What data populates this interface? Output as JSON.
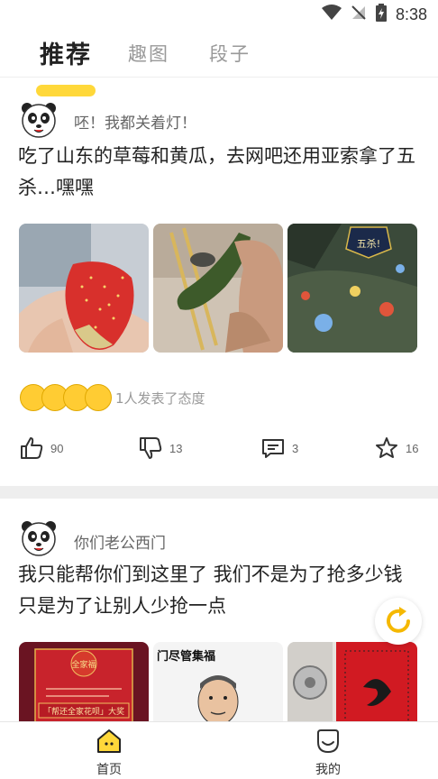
{
  "status_bar": {
    "time": "8:38"
  },
  "tabs": [
    {
      "label": "推荐",
      "active": true
    },
    {
      "label": "趣图",
      "active": false
    },
    {
      "label": "段子",
      "active": false
    }
  ],
  "posts": [
    {
      "username": "呸！我都关着灯！",
      "text": "吃了山东的草莓和黄瓜，去网吧还用亚索拿了五杀…嘿嘿",
      "images": [
        "strawberry-photo",
        "cucumber-photo",
        "game-screenshot"
      ],
      "game_overlay_text": "五杀!",
      "reactions_text": "1人发表了态度",
      "actions": {
        "like": "90",
        "dislike": "13",
        "comment": "3",
        "favorite": "16"
      }
    },
    {
      "username": "你们老公西门",
      "text": "我只能帮你们到这里了 我们不是为了抢多少钱 只是为了让别人少抢一点",
      "images": [
        "red-promo-card",
        "meme-photo",
        "red-banner-photo"
      ],
      "image1_text": "全家福",
      "image1_banner": "「帮还全家花呗」大奖",
      "image2_text": "门尽管集福"
    }
  ],
  "bottom_nav": [
    {
      "label": "首页",
      "icon": "home-icon",
      "active": true
    },
    {
      "label": "我的",
      "icon": "profile-icon",
      "active": false
    }
  ],
  "colors": {
    "accent": "#ffd83a",
    "refresh": "#f5b800"
  }
}
